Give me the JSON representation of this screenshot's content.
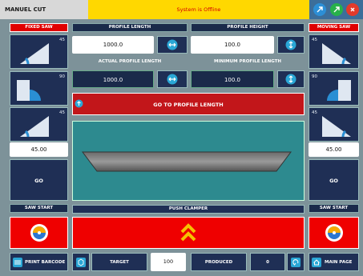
{
  "header": {
    "title": "MANUEL CUT",
    "status": "System is Offline"
  },
  "left_saw": {
    "title": "FIXED SAW",
    "angles": [
      "45",
      "90",
      "45"
    ],
    "angle_value": "45.00",
    "go_label": "GO",
    "saw_start_label": "SAW START"
  },
  "right_saw": {
    "title": "MOVING SAW",
    "angles": [
      "45",
      "90",
      "45"
    ],
    "angle_value": "45.00",
    "go_label": "GO",
    "saw_start_label": "SAW START"
  },
  "profile": {
    "length_label": "PROFILE LENGTH",
    "length_value": "1000.0",
    "height_label": "PROFILE HEIGHT",
    "height_value": "100.0",
    "actual_length_label": "ACTUAL PROFILE LENGTH",
    "actual_length_value": "1000.0",
    "min_length_label": "MINIMUM PROFILE LENGTH",
    "min_length_value": "100.0",
    "go_to_label": "GO TO PROFILE LENGTH"
  },
  "push_clamper": {
    "label": "PUSH CLAMPER"
  },
  "footer": {
    "print_barcode": "PRINT BARCODE",
    "target_label": "TARGET",
    "target_value": "100",
    "produced_label": "PRODUCED",
    "produced_value": "0",
    "main_page": "MAIN PAGE"
  },
  "colors": {
    "status_bg": "#ffd800",
    "status_text": "#d40000",
    "alarm_red": "#ef0000",
    "panel_navy": "#1f2f55",
    "canvas_teal": "#2d8a8f"
  },
  "icons": {
    "top": [
      "round-arrow-icon",
      "round-check-icon",
      "round-exit-icon"
    ]
  }
}
